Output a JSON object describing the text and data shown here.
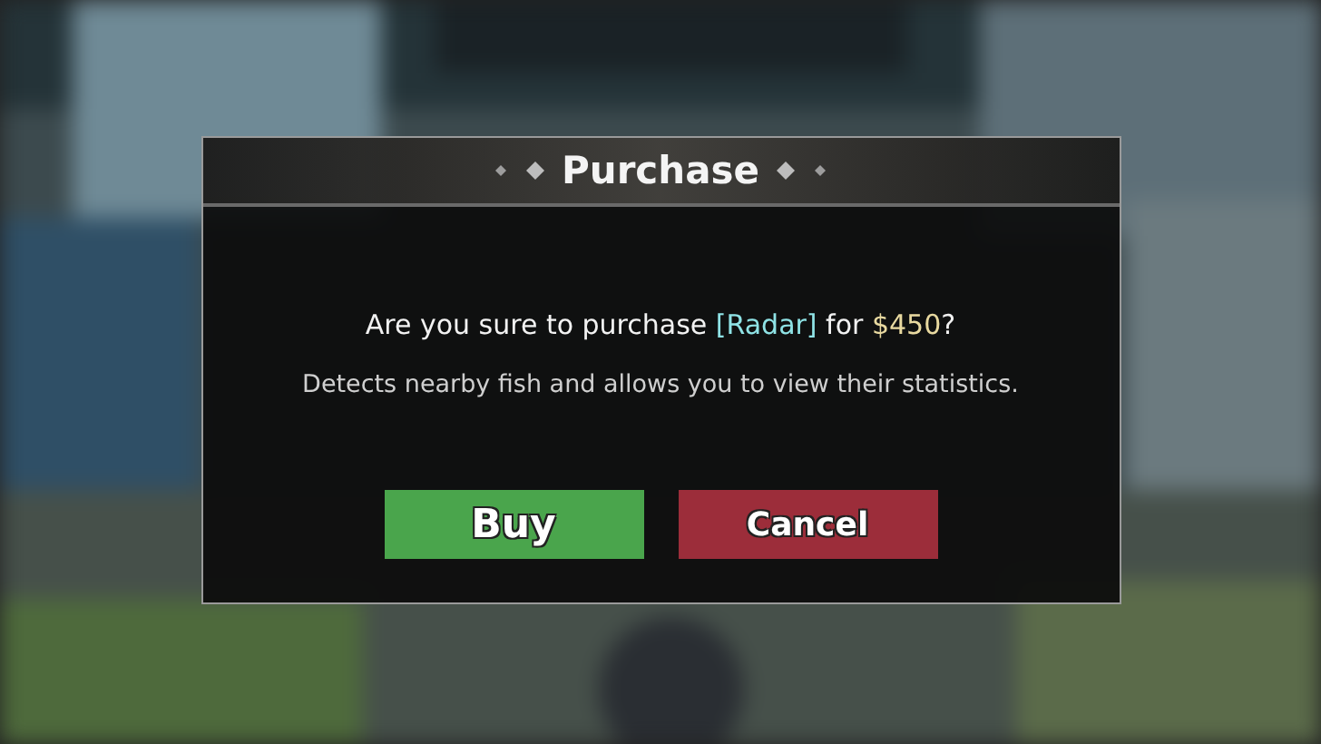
{
  "dialog": {
    "title": "Purchase",
    "question": [
      {
        "text": "Are you sure to purchase ",
        "color": "#f2f2f2"
      },
      {
        "text": "[Radar]",
        "color": "#8fe3e6"
      },
      {
        "text": " for ",
        "color": "#f2f2f2"
      },
      {
        "text": "$450",
        "color": "#e8d9a0"
      },
      {
        "text": "?",
        "color": "#f2f2f2"
      }
    ],
    "description": "Detects nearby fish and allows you to view their statistics.",
    "buttons": [
      {
        "label": "Buy",
        "kind": "confirm"
      },
      {
        "label": "Cancel",
        "kind": "cancel"
      }
    ]
  }
}
